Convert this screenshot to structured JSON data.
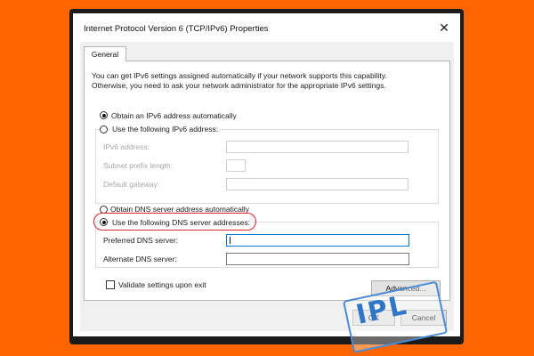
{
  "window": {
    "title": "Internet Protocol Version 6 (TCP/IPv6) Properties",
    "close_glyph": "✕"
  },
  "tabs": [
    {
      "label": "General",
      "selected": true
    }
  ],
  "description": {
    "line1": "You can get IPv6 settings assigned automatically if your network supports this capability.",
    "line2": "Otherwise, you need to ask your network administrator for the appropriate IPv6 settings."
  },
  "address": {
    "auto_label": "Obtain an IPv6 address automatically",
    "auto_selected": true,
    "manual_label": "Use the following IPv6 address:",
    "manual_selected": false,
    "fields": {
      "ipv6_label": "IPv6 address:",
      "prefix_label": "Subnet prefix length:",
      "gateway_label": "Default gateway:"
    }
  },
  "dns": {
    "auto_label": "Obtain DNS server address automatically",
    "auto_selected": false,
    "manual_label": "Use the following DNS server addresses:",
    "manual_selected": true,
    "preferred_label": "Preferred DNS server:",
    "preferred_value": "",
    "alternate_label": "Alternate DNS server:",
    "alternate_value": ""
  },
  "validate": {
    "label": "Validate settings upon exit",
    "checked": false
  },
  "buttons": {
    "advanced": "Advanced...",
    "ok": "OK",
    "cancel": "Cancel"
  },
  "watermark": {
    "text": "IPL"
  },
  "colors": {
    "background": "#fd6500",
    "highlight": "#d9232e",
    "focus": "#0078d7"
  }
}
